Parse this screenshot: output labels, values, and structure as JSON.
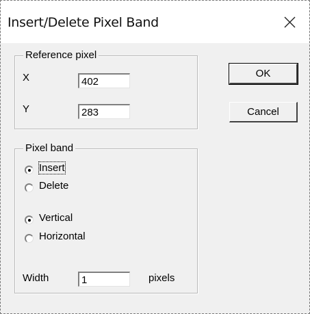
{
  "window": {
    "title": "Insert/Delete Pixel Band"
  },
  "reference_pixel": {
    "legend": "Reference pixel",
    "x_label": "X",
    "x_value": "402",
    "y_label": "Y",
    "y_value": "283"
  },
  "buttons": {
    "ok": "OK",
    "cancel": "Cancel"
  },
  "pixel_band": {
    "legend": "Pixel band",
    "insert": "Insert",
    "delete": "Delete",
    "vertical": "Vertical",
    "horizontal": "Horizontal",
    "selected_action": "Insert",
    "selected_orientation": "Vertical",
    "width_label": "Width",
    "width_value": "1",
    "width_unit": "pixels"
  }
}
